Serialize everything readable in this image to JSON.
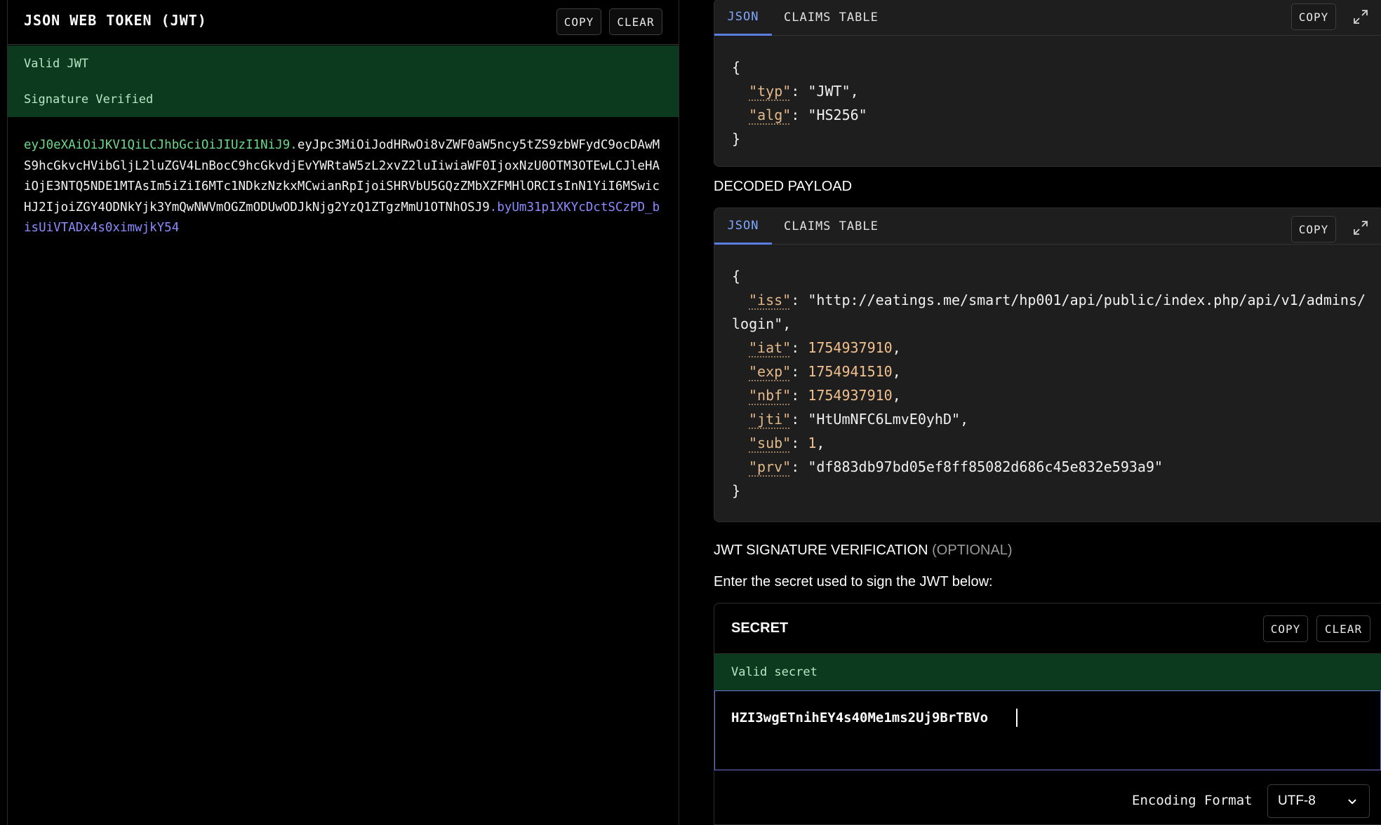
{
  "token_panel": {
    "title": "JSON WEB TOKEN (JWT)",
    "copy_label": "COPY",
    "clear_label": "CLEAR",
    "status_valid": "Valid JWT",
    "status_signature": "Signature Verified",
    "token_header": "eyJ0eXAiOiJKV1QiLCJhbGciOiJIUzI1NiJ9",
    "token_dot1": ".",
    "token_payload": "eyJpc3MiOiJodHRwOi8vZWF0aW5ncy5tZS9zbWFydC9ocDAwMS9hcGkvcHVibGljL2luZGV4LnBocC9hcGkvdjEvYWRtaW5zL2xvZ2luIiwiaWF0IjoxNzU0OTM3OTEwLCJleHAiOjE3NTQ5NDE1MTAsIm5iZiI6MTc1NDkzNzkxMCwianRpIjoiSHRVbU5GQzZMbXZFMHlORCIsInN1YiI6MSwicHJ2IjoiZGY4ODNkYjk3YmQwNWVmOGZmODUwODJkNjg2YzQ1ZTgzMmU1OTNhOSJ9",
    "token_dot2": ".",
    "token_signature": "byUm31p1XKYcDctSCzPD_bisUiVTADx4s0ximwjkY54"
  },
  "header_card": {
    "tab_json": "JSON",
    "tab_claims": "CLAIMS TABLE",
    "copy_label": "COPY",
    "lines": {
      "open": "{",
      "k1": "\"typ\"",
      "v1": "\"JWT\"",
      "k2": "\"alg\"",
      "v2": "\"HS256\"",
      "close": "}"
    }
  },
  "payload_section": {
    "title": "DECODED PAYLOAD",
    "tab_json": "JSON",
    "tab_claims": "CLAIMS TABLE",
    "copy_label": "COPY",
    "open": "{",
    "close": "}",
    "iss_key": "\"iss\"",
    "iss_value": "\"http://eatings.me/smart/hp001/api/public/index.php/api/v1/admins/login\"",
    "iat_key": "\"iat\"",
    "iat_value": "1754937910",
    "exp_key": "\"exp\"",
    "exp_value": "1754941510",
    "nbf_key": "\"nbf\"",
    "nbf_value": "1754937910",
    "jti_key": "\"jti\"",
    "jti_value": "\"HtUmNFC6LmvE0yhD\"",
    "sub_key": "\"sub\"",
    "sub_value": "1",
    "prv_key": "\"prv\"",
    "prv_value": "\"df883db97bd05ef8ff85082d686c45e832e593a9\""
  },
  "verification": {
    "title": "JWT SIGNATURE VERIFICATION",
    "title_optional": "(OPTIONAL)",
    "instructions": "Enter the secret used to sign the JWT below:",
    "secret_label": "SECRET",
    "copy_label": "COPY",
    "clear_label": "CLEAR",
    "status": "Valid secret",
    "secret_value": "HZI3wgETnihEY4s40Me1ms2Uj9BrTBVo",
    "encoding_label": "Encoding Format",
    "encoding_value": "UTF-8"
  }
}
